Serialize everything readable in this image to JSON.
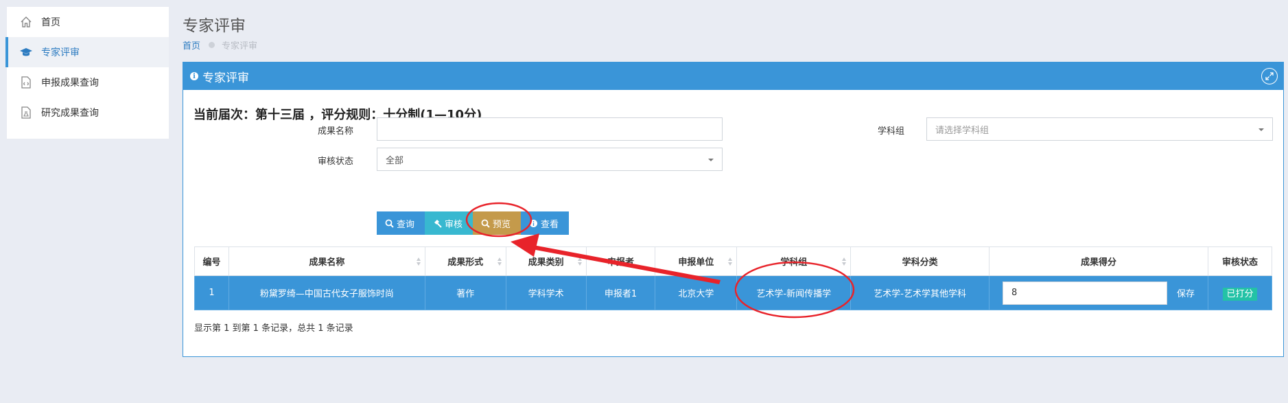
{
  "sidebar": {
    "items": [
      {
        "label": "首页",
        "icon": "home-icon"
      },
      {
        "label": "专家评审",
        "icon": "graduation-cap-icon",
        "active": true
      },
      {
        "label": "申报成果查询",
        "icon": "code-file-icon"
      },
      {
        "label": "研究成果查询",
        "icon": "flask-file-icon"
      }
    ]
  },
  "header": {
    "title": "专家评审",
    "breadcrumb": {
      "home": "首页",
      "current": "专家评审"
    }
  },
  "panel": {
    "title": "专家评审",
    "round_info": "当前届次：第十三届 ，评分规则：十分制(1—10分)"
  },
  "filters": {
    "name_label": "成果名称",
    "name_value": "",
    "group_label": "学科组",
    "group_placeholder": "请选择学科组",
    "status_label": "审核状态",
    "status_value": "全部"
  },
  "toolbar": {
    "query_label": "查询",
    "review_label": "审核",
    "preview_label": "预览",
    "view_label": "查看"
  },
  "table": {
    "columns": [
      "编号",
      "成果名称",
      "成果形式",
      "成果类别",
      "申报者",
      "申报单位",
      "学科组",
      "学科分类",
      "成果得分",
      "审核状态"
    ],
    "rows": [
      {
        "id": "1",
        "name": "粉黛罗绮—中国古代女子服饰时尚",
        "form": "著作",
        "category": "学科学术",
        "applicant": "申报者1",
        "unit": "北京大学",
        "group": "艺术学-新闻传播学",
        "classification": "艺术学-艺术学其他学科",
        "score": "8",
        "save_label": "保存",
        "status": "已打分"
      }
    ]
  },
  "footer": {
    "summary": "显示第 1 到第 1 条记录，总共 1 条记录"
  },
  "colors": {
    "primary": "#3a95d8",
    "teal": "#38b8d0",
    "gold": "#c49a4b",
    "badge": "#23c2a6",
    "annotation": "#e8232a"
  }
}
